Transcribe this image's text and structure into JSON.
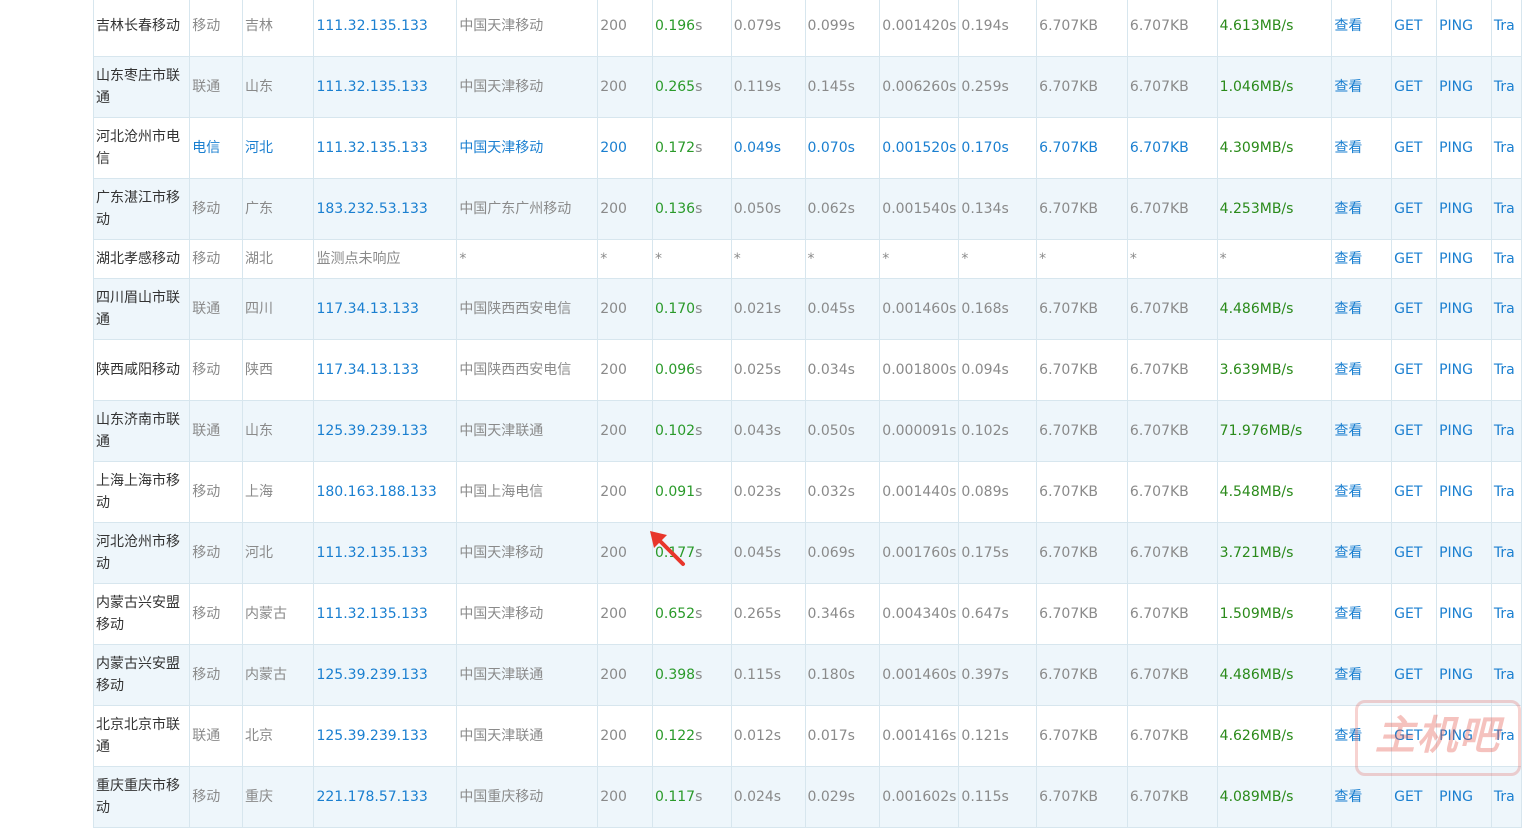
{
  "rows": [
    {
      "node": "吉林长春移动",
      "isp": "移动",
      "prov": "吉林",
      "ip": "111.32.135.133",
      "loc": "中国天津移动",
      "code": "200",
      "total": "0.196",
      "unit": "s",
      "dns": "0.079s",
      "connect": "0.099s",
      "download": "0.001420s",
      "first": "0.194s",
      "size": "6.707KB",
      "dsize": "6.707KB",
      "speed": "4.613MB/s",
      "view": "查看",
      "get": "GET",
      "ping": "PING",
      "tr": "Tra"
    },
    {
      "node": "山东枣庄市联通",
      "isp": "联通",
      "prov": "山东",
      "ip": "111.32.135.133",
      "loc": "中国天津移动",
      "code": "200",
      "total": "0.265",
      "unit": "s",
      "dns": "0.119s",
      "connect": "0.145s",
      "download": "0.006260s",
      "first": "0.259s",
      "size": "6.707KB",
      "dsize": "6.707KB",
      "speed": "1.046MB/s",
      "view": "查看",
      "get": "GET",
      "ping": "PING",
      "tr": "Tra"
    },
    {
      "node": "河北沧州市电信",
      "isp": "电信",
      "prov": "河北",
      "ip": "111.32.135.133",
      "loc": "中国天津移动",
      "code": "200",
      "total": "0.172",
      "unit": "s",
      "dns": "0.049s",
      "connect": "0.070s",
      "download": "0.001520s",
      "first": "0.170s",
      "size": "6.707KB",
      "dsize": "6.707KB",
      "speed": "4.309MB/s",
      "view": "查看",
      "get": "GET",
      "ping": "PING",
      "tr": "Tra",
      "highlight": true
    },
    {
      "node": "广东湛江市移动",
      "isp": "移动",
      "prov": "广东",
      "ip": "183.232.53.133",
      "loc": "中国广东广州移动",
      "code": "200",
      "total": "0.136",
      "unit": "s",
      "dns": "0.050s",
      "connect": "0.062s",
      "download": "0.001540s",
      "first": "0.134s",
      "size": "6.707KB",
      "dsize": "6.707KB",
      "speed": "4.253MB/s",
      "view": "查看",
      "get": "GET",
      "ping": "PING",
      "tr": "Tra"
    },
    {
      "node": "湖北孝感移动",
      "isp": "移动",
      "prov": "湖北",
      "ip": "监测点未响应",
      "loc": "*",
      "code": "*",
      "total": "*",
      "unit": "",
      "dns": "*",
      "connect": "*",
      "download": "*",
      "first": "*",
      "size": "*",
      "dsize": "*",
      "speed": "*",
      "view": "查看",
      "get": "GET",
      "ping": "PING",
      "tr": "Tra",
      "noresp": true
    },
    {
      "node": "四川眉山市联通",
      "isp": "联通",
      "prov": "四川",
      "ip": "117.34.13.133",
      "loc": "中国陕西西安电信",
      "code": "200",
      "total": "0.170",
      "unit": "s",
      "dns": "0.021s",
      "connect": "0.045s",
      "download": "0.001460s",
      "first": "0.168s",
      "size": "6.707KB",
      "dsize": "6.707KB",
      "speed": "4.486MB/s",
      "view": "查看",
      "get": "GET",
      "ping": "PING",
      "tr": "Tra"
    },
    {
      "node": "陕西咸阳移动",
      "isp": "移动",
      "prov": "陕西",
      "ip": "117.34.13.133",
      "loc": "中国陕西西安电信",
      "code": "200",
      "total": "0.096",
      "unit": "s",
      "dns": "0.025s",
      "connect": "0.034s",
      "download": "0.001800s",
      "first": "0.094s",
      "size": "6.707KB",
      "dsize": "6.707KB",
      "speed": "3.639MB/s",
      "view": "查看",
      "get": "GET",
      "ping": "PING",
      "tr": "Tra"
    },
    {
      "node": "山东济南市联通",
      "isp": "联通",
      "prov": "山东",
      "ip": "125.39.239.133",
      "loc": "中国天津联通",
      "code": "200",
      "total": "0.102",
      "unit": "s",
      "dns": "0.043s",
      "connect": "0.050s",
      "download": "0.000091s",
      "first": "0.102s",
      "size": "6.707KB",
      "dsize": "6.707KB",
      "speed": "71.976MB/s",
      "view": "查看",
      "get": "GET",
      "ping": "PING",
      "tr": "Tra"
    },
    {
      "node": "上海上海市移动",
      "isp": "移动",
      "prov": "上海",
      "ip": "180.163.188.133",
      "loc": "中国上海电信",
      "code": "200",
      "total": "0.091",
      "unit": "s",
      "dns": "0.023s",
      "connect": "0.032s",
      "download": "0.001440s",
      "first": "0.089s",
      "size": "6.707KB",
      "dsize": "6.707KB",
      "speed": "4.548MB/s",
      "view": "查看",
      "get": "GET",
      "ping": "PING",
      "tr": "Tra"
    },
    {
      "node": "河北沧州市移动",
      "isp": "移动",
      "prov": "河北",
      "ip": "111.32.135.133",
      "loc": "中国天津移动",
      "code": "200",
      "total": "0.177",
      "unit": "s",
      "dns": "0.045s",
      "connect": "0.069s",
      "download": "0.001760s",
      "first": "0.175s",
      "size": "6.707KB",
      "dsize": "6.707KB",
      "speed": "3.721MB/s",
      "view": "查看",
      "get": "GET",
      "ping": "PING",
      "tr": "Tra"
    },
    {
      "node": "内蒙古兴安盟移动",
      "isp": "移动",
      "prov": "内蒙古",
      "ip": "111.32.135.133",
      "loc": "中国天津移动",
      "code": "200",
      "total": "0.652",
      "unit": "s",
      "dns": "0.265s",
      "connect": "0.346s",
      "download": "0.004340s",
      "first": "0.647s",
      "size": "6.707KB",
      "dsize": "6.707KB",
      "speed": "1.509MB/s",
      "view": "查看",
      "get": "GET",
      "ping": "PING",
      "tr": "Tra"
    },
    {
      "node": "内蒙古兴安盟移动",
      "isp": "移动",
      "prov": "内蒙古",
      "ip": "125.39.239.133",
      "loc": "中国天津联通",
      "code": "200",
      "total": "0.398",
      "unit": "s",
      "dns": "0.115s",
      "connect": "0.180s",
      "download": "0.001460s",
      "first": "0.397s",
      "size": "6.707KB",
      "dsize": "6.707KB",
      "speed": "4.486MB/s",
      "view": "查看",
      "get": "GET",
      "ping": "PING",
      "tr": "Tra"
    },
    {
      "node": "北京北京市联通",
      "isp": "联通",
      "prov": "北京",
      "ip": "125.39.239.133",
      "loc": "中国天津联通",
      "code": "200",
      "total": "0.122",
      "unit": "s",
      "dns": "0.012s",
      "connect": "0.017s",
      "download": "0.001416s",
      "first": "0.121s",
      "size": "6.707KB",
      "dsize": "6.707KB",
      "speed": "4.626MB/s",
      "view": "查看",
      "get": "GET",
      "ping": "PING",
      "tr": "Tra"
    },
    {
      "node": "重庆重庆市移动",
      "isp": "移动",
      "prov": "重庆",
      "ip": "221.178.57.133",
      "loc": "中国重庆移动",
      "code": "200",
      "total": "0.117",
      "unit": "s",
      "dns": "0.024s",
      "connect": "0.029s",
      "download": "0.001602s",
      "first": "0.115s",
      "size": "6.707KB",
      "dsize": "6.707KB",
      "speed": "4.089MB/s",
      "view": "查看",
      "get": "GET",
      "ping": "PING",
      "tr": "Tra"
    }
  ],
  "watermark": "主机吧",
  "colors": {
    "link": "#1a7fd0",
    "fast": "#2a9a2a",
    "border": "#d7e6ee",
    "stripe": "#eef6fb",
    "arrow": "#e8362b"
  }
}
